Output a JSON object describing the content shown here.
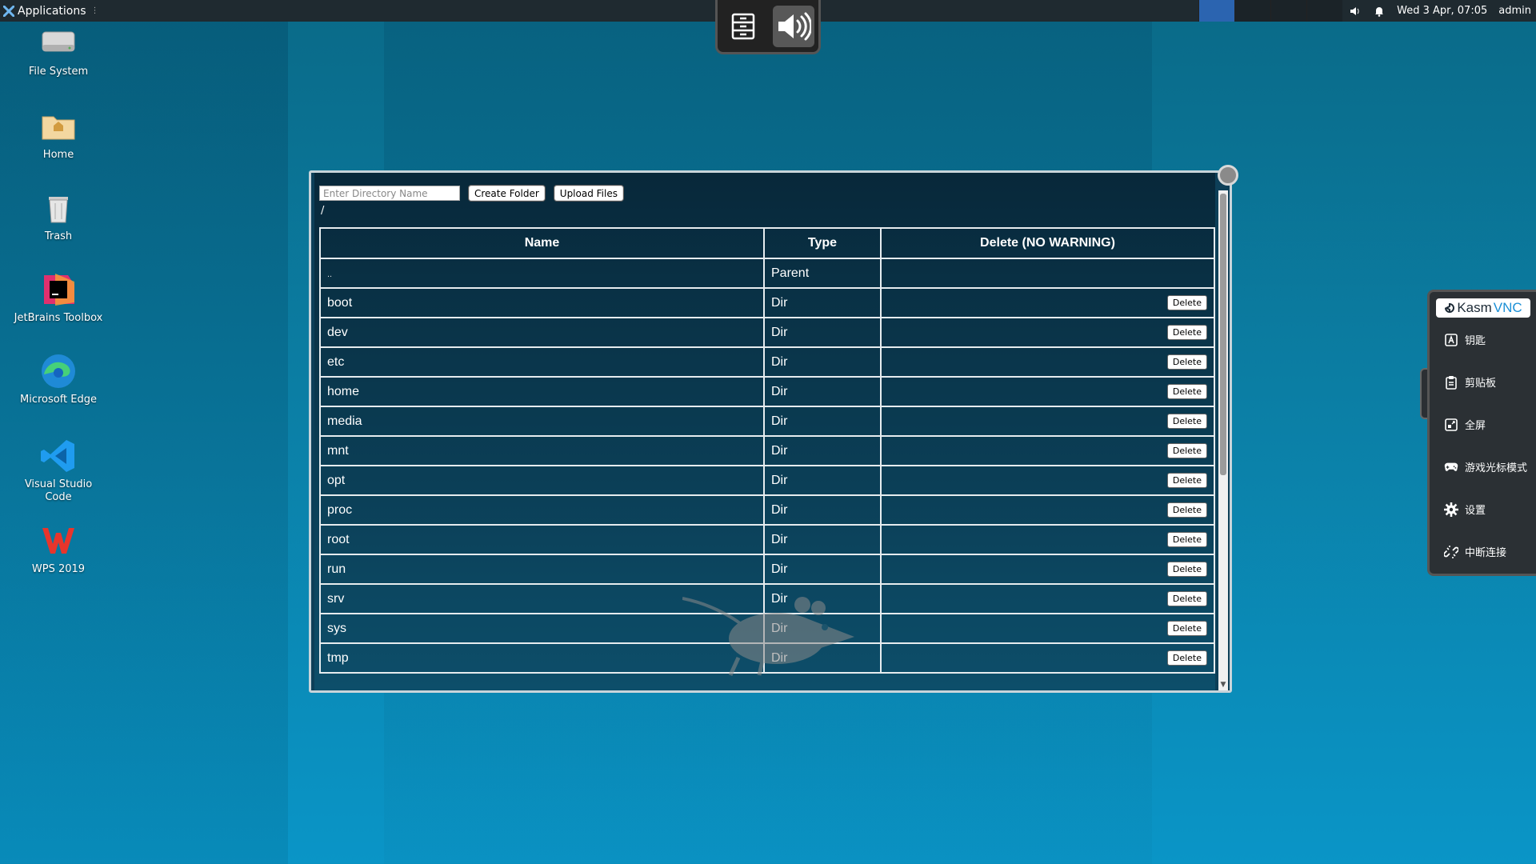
{
  "topbar": {
    "applications_label": "Applications",
    "datetime": "Wed  3 Apr, 07:05",
    "user": "admin"
  },
  "desktop": {
    "icons": [
      {
        "label": "File System",
        "icon": "drive-icon"
      },
      {
        "label": "Home",
        "icon": "home-folder-icon"
      },
      {
        "label": "Trash",
        "icon": "trash-icon"
      },
      {
        "label": "JetBrains Toolbox",
        "icon": "jetbrains-toolbox-icon"
      },
      {
        "label": "Microsoft Edge",
        "icon": "edge-icon"
      },
      {
        "label": "Visual Studio Code",
        "icon": "vscode-icon"
      },
      {
        "label": "WPS 2019",
        "icon": "wps-icon"
      }
    ]
  },
  "filemanager": {
    "dir_placeholder": "Enter Directory Name",
    "create_folder_label": "Create Folder",
    "upload_files_label": "Upload Files",
    "path": "/",
    "headers": {
      "name": "Name",
      "type": "Type",
      "delete": "Delete (NO WARNING)"
    },
    "parent_row": {
      "name": "..",
      "type": "Parent"
    },
    "delete_label": "Delete",
    "rows": [
      {
        "name": "boot",
        "type": "Dir"
      },
      {
        "name": "dev",
        "type": "Dir"
      },
      {
        "name": "etc",
        "type": "Dir"
      },
      {
        "name": "home",
        "type": "Dir"
      },
      {
        "name": "media",
        "type": "Dir"
      },
      {
        "name": "mnt",
        "type": "Dir"
      },
      {
        "name": "opt",
        "type": "Dir"
      },
      {
        "name": "proc",
        "type": "Dir"
      },
      {
        "name": "root",
        "type": "Dir"
      },
      {
        "name": "run",
        "type": "Dir"
      },
      {
        "name": "srv",
        "type": "Dir"
      },
      {
        "name": "sys",
        "type": "Dir"
      },
      {
        "name": "tmp",
        "type": "Dir"
      }
    ]
  },
  "kasm": {
    "logo_a": "Kasm",
    "logo_b": "VNC",
    "items": [
      {
        "label": "钥匙",
        "icon": "keyboard-icon"
      },
      {
        "label": "剪贴板",
        "icon": "clipboard-icon"
      },
      {
        "label": "全屏",
        "icon": "fullscreen-icon"
      },
      {
        "label": "游戏光标模式",
        "icon": "gamepad-icon"
      },
      {
        "label": "设置",
        "icon": "gear-icon"
      },
      {
        "label": "中断连接",
        "icon": "disconnect-icon"
      }
    ]
  }
}
